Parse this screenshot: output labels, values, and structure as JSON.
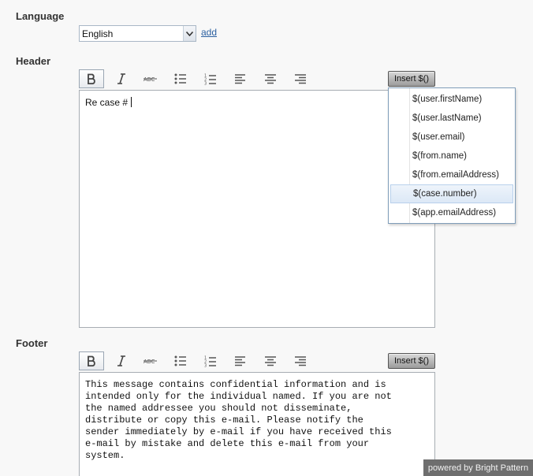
{
  "language": {
    "label": "Language",
    "selected": "English",
    "add_link": "add"
  },
  "header": {
    "label": "Header",
    "content": "Re case #",
    "insert_label": "Insert $()"
  },
  "insert_menu": {
    "items": [
      "$(user.firstName)",
      "$(user.lastName)",
      "$(user.email)",
      "$(from.name)",
      "$(from.emailAddress)",
      "$(case.number)",
      "$(app.emailAddress)"
    ],
    "selected": "$(case.number)"
  },
  "footer": {
    "label": "Footer",
    "insert_label": "Insert $()",
    "content": "This message contains confidential information and is\nintended only for the individual named. If you are not\nthe named addressee you should not disseminate,\ndistribute or copy this e-mail. Please notify the\nsender immediately by e-mail if you have received this\ne-mail by mistake and delete this e-mail from your\nsystem."
  },
  "toolbar_icons": [
    "bold-icon",
    "italic-icon",
    "strikethrough-icon",
    "bullet-list-icon",
    "numbered-list-icon",
    "align-left-icon",
    "align-center-icon",
    "align-right-icon"
  ],
  "badge": "powered by Bright Pattern",
  "colors": {
    "link": "#2a5fa0",
    "menu_border": "#7f9db9",
    "selected_item_bg": "#dce8f6",
    "badge_bg": "#6e6e6e"
  }
}
